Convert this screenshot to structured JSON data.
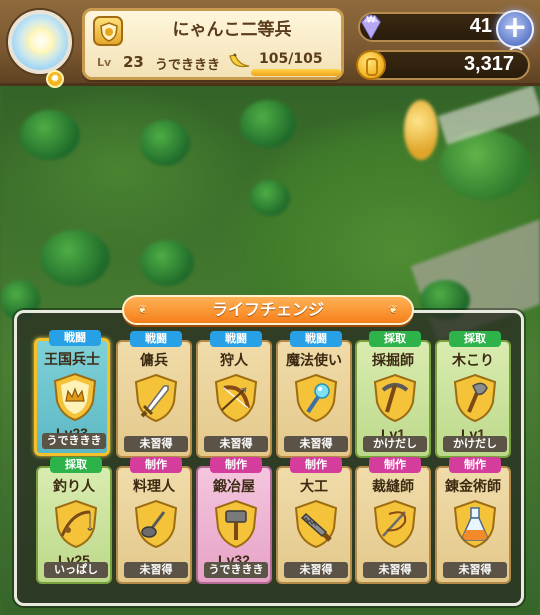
{
  "player": {
    "title": "にゃんこ二等兵",
    "lv_label": "Lv",
    "level": "23",
    "skill_label": "うでききき",
    "stamina": "105/105",
    "stamina_fraction": 1.0
  },
  "currency": {
    "gems": "41",
    "coins": "3,317"
  },
  "panel": {
    "title": "ライフチェンジ"
  },
  "jobs": [
    {
      "category": "戦闘",
      "name": "王国兵士",
      "level": "Lv23",
      "status": "うでききき",
      "icon": "soldier-crest-icon",
      "selected": true
    },
    {
      "category": "戦闘",
      "name": "傭兵",
      "level": "",
      "status": "未習得",
      "icon": "sword-icon"
    },
    {
      "category": "戦闘",
      "name": "狩人",
      "level": "",
      "status": "未習得",
      "icon": "bow-icon"
    },
    {
      "category": "戦闘",
      "name": "魔法使い",
      "level": "",
      "status": "未習得",
      "icon": "magic-staff-icon"
    },
    {
      "category": "採取",
      "name": "採掘師",
      "level": "Lv1",
      "status": "かけだし",
      "icon": "pickaxe-icon"
    },
    {
      "category": "採取",
      "name": "木こり",
      "level": "Lv1",
      "status": "かけだし",
      "icon": "axe-icon"
    },
    {
      "category": "採取",
      "name": "釣り人",
      "level": "Lv25",
      "status": "いっぱし",
      "icon": "fishing-rod-icon"
    },
    {
      "category": "制作",
      "name": "料理人",
      "level": "",
      "status": "未習得",
      "icon": "ladle-icon"
    },
    {
      "category": "制作",
      "name": "鍛冶屋",
      "level": "Lv32",
      "status": "うでききき",
      "icon": "hammer-icon"
    },
    {
      "category": "制作",
      "name": "大工",
      "level": "",
      "status": "未習得",
      "icon": "saw-icon"
    },
    {
      "category": "制作",
      "name": "裁縫師",
      "level": "",
      "status": "未習得",
      "icon": "needle-thread-icon"
    },
    {
      "category": "制作",
      "name": "錬金術師",
      "level": "",
      "status": "未習得",
      "icon": "flask-icon"
    }
  ]
}
